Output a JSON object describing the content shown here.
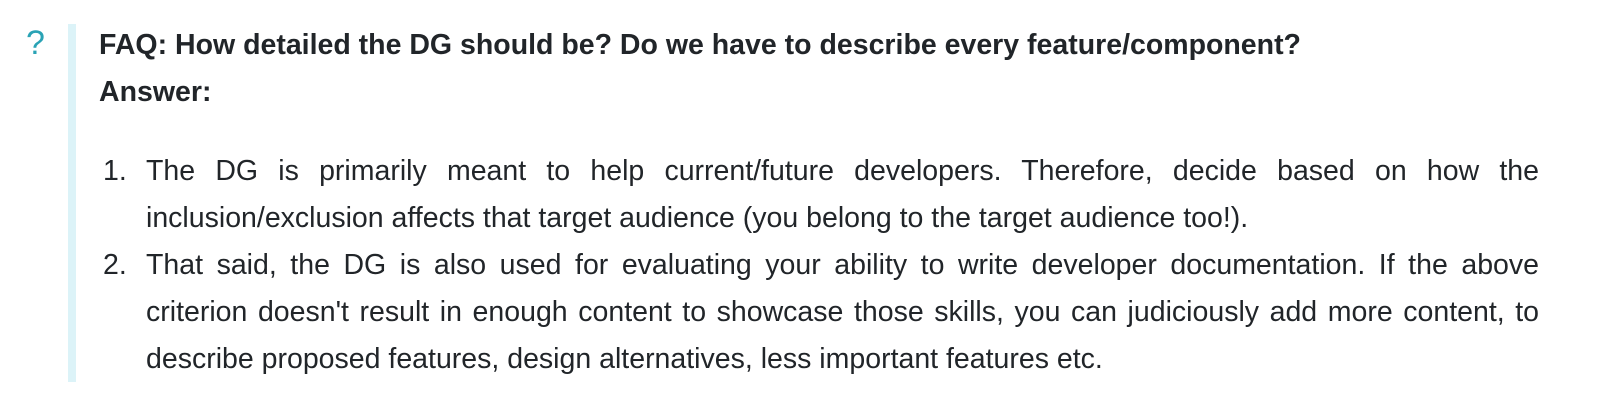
{
  "icon": "question-mark-icon",
  "icon_glyph": "?",
  "colors": {
    "accent": "#2aa3b5",
    "side_bar": "#dcf3f8",
    "text": "#212529"
  },
  "faq": {
    "question": "FAQ: How detailed the DG should be? Do we have to describe every feature/component?",
    "answer_label": "Answer:",
    "items": [
      {
        "number": "1.",
        "text": "The DG is primarily meant to help current/future developers. Therefore, decide based on how the inclusion/exclusion affects that target audience (you belong to the target audience too!)."
      },
      {
        "number": "2.",
        "text": "That said, the DG is also used for evaluating your ability to write developer documentation. If the above criterion doesn't result in enough content to showcase those skills, you can judiciously add more content, to describe proposed features, design alternatives, less important features etc."
      }
    ]
  }
}
